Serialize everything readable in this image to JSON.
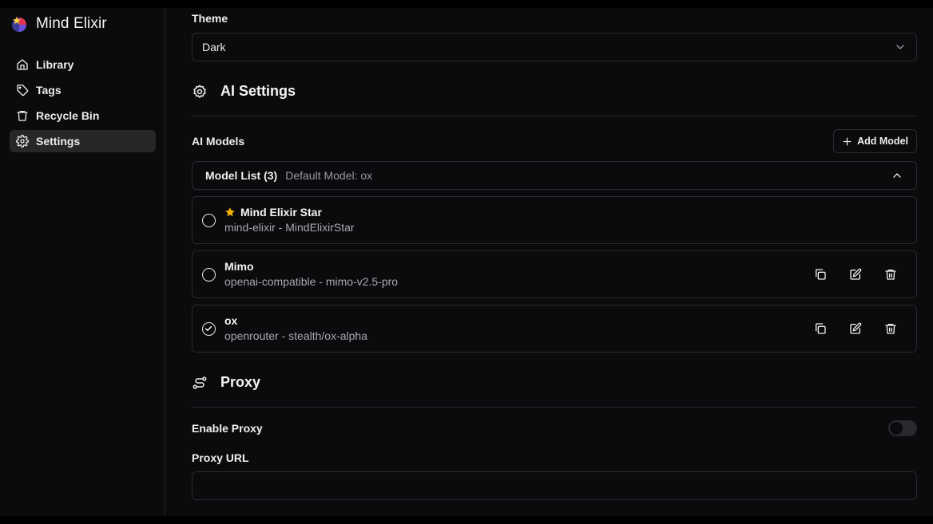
{
  "app": {
    "name": "Mind Elixir"
  },
  "sidebar": {
    "items": [
      {
        "label": "Library",
        "icon": "home-icon",
        "active": false
      },
      {
        "label": "Tags",
        "icon": "tag-icon",
        "active": false
      },
      {
        "label": "Recycle Bin",
        "icon": "trash-icon",
        "active": false
      },
      {
        "label": "Settings",
        "icon": "gear-icon",
        "active": true
      }
    ]
  },
  "theme": {
    "label": "Theme",
    "value": "Dark"
  },
  "ai_settings": {
    "title": "AI Settings",
    "models_label": "AI Models",
    "add_model_label": "Add Model",
    "model_list": {
      "title": "Model List (3)",
      "default_text": "Default Model: ox"
    },
    "models": [
      {
        "name": "Mind Elixir Star",
        "sub": "mind-elixir - MindElixirStar",
        "starred": true,
        "selected": false
      },
      {
        "name": "Mimo",
        "sub": "openai-compatible - mimo-v2.5-pro",
        "starred": false,
        "selected": false
      },
      {
        "name": "ox",
        "sub": "openrouter - stealth/ox-alpha",
        "starred": false,
        "selected": true
      }
    ]
  },
  "proxy": {
    "title": "Proxy",
    "enable_label": "Enable Proxy",
    "enabled": false,
    "url_label": "Proxy URL",
    "url_value": ""
  },
  "colors": {
    "background": "#0b0b0d",
    "border": "#2b2b2f",
    "accent_star": "#f5b301",
    "active_nav": "#27272a"
  }
}
